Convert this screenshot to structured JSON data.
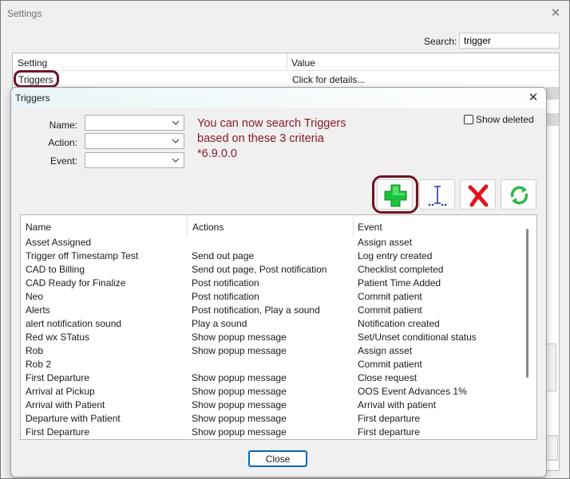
{
  "settings_window": {
    "title": "Settings",
    "close_glyph": "✕",
    "search_label": "Search:",
    "search_value": "trigger",
    "columns": {
      "setting": "Setting",
      "value": "Value"
    },
    "rows": [
      {
        "setting": "Triggers",
        "value": "Click for details..."
      }
    ]
  },
  "triggers_dialog": {
    "title": "Triggers",
    "close_glyph": "✕",
    "filters": {
      "name_label": "Name:",
      "action_label": "Action:",
      "event_label": "Event:"
    },
    "note_lines": [
      "You can now search Triggers",
      "based on these 3 criteria",
      "*6.9.0.0"
    ],
    "show_deleted_label": "Show deleted",
    "show_deleted_checked": false,
    "toolbar_icons": [
      "add-icon",
      "insert-cursor-icon",
      "delete-icon",
      "refresh-icon"
    ],
    "columns": {
      "name": "Name",
      "actions": "Actions",
      "event": "Event"
    },
    "rows": [
      {
        "name": "Asset Assigned",
        "actions": "",
        "event": "Assign asset"
      },
      {
        "name": "Trigger off Timestamp Test",
        "actions": "Send out page",
        "event": "Log entry created"
      },
      {
        "name": "CAD to Billing",
        "actions": "Send out page, Post notification",
        "event": "Checklist completed"
      },
      {
        "name": "CAD Ready for Finalize",
        "actions": "Post notification",
        "event": "Patient Time Added"
      },
      {
        "name": "Neo",
        "actions": "Post notification",
        "event": "Commit patient"
      },
      {
        "name": "Alerts",
        "actions": "Post notification, Play a sound",
        "event": "Commit patient"
      },
      {
        "name": "alert notification sound",
        "actions": "Play a sound",
        "event": "Notification created"
      },
      {
        "name": "Red wx STatus",
        "actions": "Show popup message",
        "event": "Set/Unset conditional status"
      },
      {
        "name": "Rob",
        "actions": "Show popup message",
        "event": "Assign asset"
      },
      {
        "name": "Rob 2",
        "actions": "",
        "event": "Commit patient"
      },
      {
        "name": "First Departure",
        "actions": "Show popup message",
        "event": "Close request"
      },
      {
        "name": "Arrival at Pickup",
        "actions": "Show popup message",
        "event": "OOS Event Advances 1%"
      },
      {
        "name": "Arrival with Patient",
        "actions": "Show popup message",
        "event": "Arrival with patient"
      },
      {
        "name": "Departure with Patient",
        "actions": "Show popup message",
        "event": "First departure"
      },
      {
        "name": "First Departure",
        "actions": "Show popup message",
        "event": "First departure"
      }
    ],
    "close_button": "Close"
  },
  "colors": {
    "highlight_ring": "#6e1326",
    "note_text": "#8b1a2a",
    "add_green": "#19c43a",
    "delete_red": "#e0141e",
    "refresh_green": "#2db84a",
    "cursor_blue": "#2a3aa8"
  }
}
